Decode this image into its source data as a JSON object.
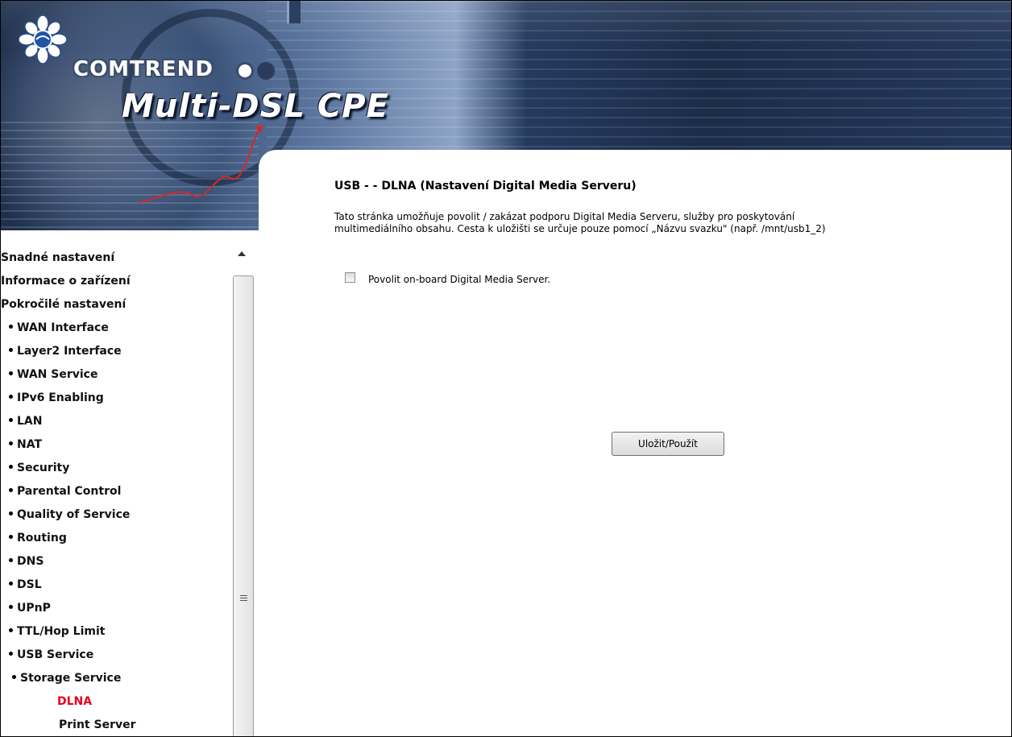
{
  "banner": {
    "brand": "COMTREND",
    "product": "Multi-DSL CPE"
  },
  "page": {
    "title": "USB - - DLNA (Nastavení Digital Media Serveru)",
    "description_line1": "Tato stránka umožňuje povolit / zakázat podporu Digital Media Serveru, služby pro poskytování",
    "description_line2": "multimediálního obsahu. Cesta k uložišti se určuje pouze pomocí „Názvu svazku\" (např. /mnt/usb1_2)",
    "enable_label": "Povolit on-board Digital Media Server.",
    "enable_checked": false,
    "save_label": "Uložit/Použít"
  },
  "menu": {
    "items": [
      {
        "label": "Snadné nastavení"
      },
      {
        "label": "Informace o zařízení"
      },
      {
        "label": "Pokročilé nastavení"
      },
      {
        "label": "WAN Interface"
      },
      {
        "label": "Layer2 Interface"
      },
      {
        "label": "WAN Service"
      },
      {
        "label": "IPv6 Enabling"
      },
      {
        "label": "LAN"
      },
      {
        "label": "NAT"
      },
      {
        "label": "Security"
      },
      {
        "label": "Parental Control"
      },
      {
        "label": "Quality of Service"
      },
      {
        "label": "Routing"
      },
      {
        "label": "DNS"
      },
      {
        "label": "DSL"
      },
      {
        "label": "UPnP"
      },
      {
        "label": "TTL/Hop Limit"
      },
      {
        "label": "USB Service"
      },
      {
        "label": "Storage Service"
      },
      {
        "label": "DLNA"
      },
      {
        "label": "Print Server"
      }
    ]
  },
  "colors": {
    "active_menu": "#e8001d",
    "banner_dark": "#1d2e4a"
  }
}
